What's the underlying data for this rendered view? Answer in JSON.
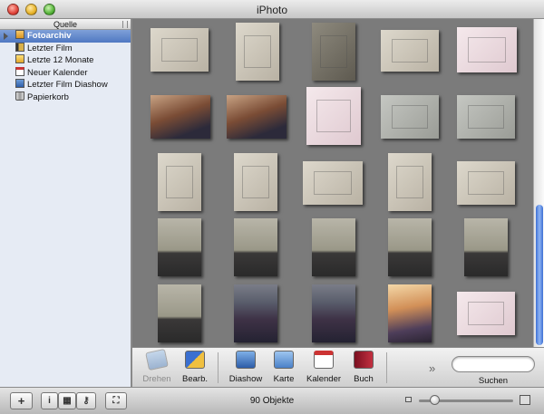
{
  "window": {
    "title": "iPhoto"
  },
  "sidebar": {
    "header": "Quelle",
    "items": [
      {
        "label": "Fotoarchiv",
        "icon": "photo-library-icon",
        "selected": true
      },
      {
        "label": "Letzter Film",
        "icon": "film-roll-icon"
      },
      {
        "label": "Letzte 12 Monate",
        "icon": "calendar-months-icon"
      },
      {
        "label": "Neuer Kalender",
        "icon": "calendar-icon"
      },
      {
        "label": "Letzter Film Diashow",
        "icon": "slideshow-icon"
      },
      {
        "label": "Papierkorb",
        "icon": "trash-icon"
      }
    ]
  },
  "toolbar": {
    "rotate_label": "Drehen",
    "edit_label": "Bearb.",
    "slideshow_label": "Diashow",
    "card_label": "Karte",
    "calendar_label": "Kalender",
    "book_label": "Buch",
    "search_label": "Suchen",
    "search_value": ""
  },
  "status": {
    "count": "90 Objekte"
  },
  "colors": {
    "accent": "#4f78c2",
    "scroll": "#3d6fd4"
  }
}
